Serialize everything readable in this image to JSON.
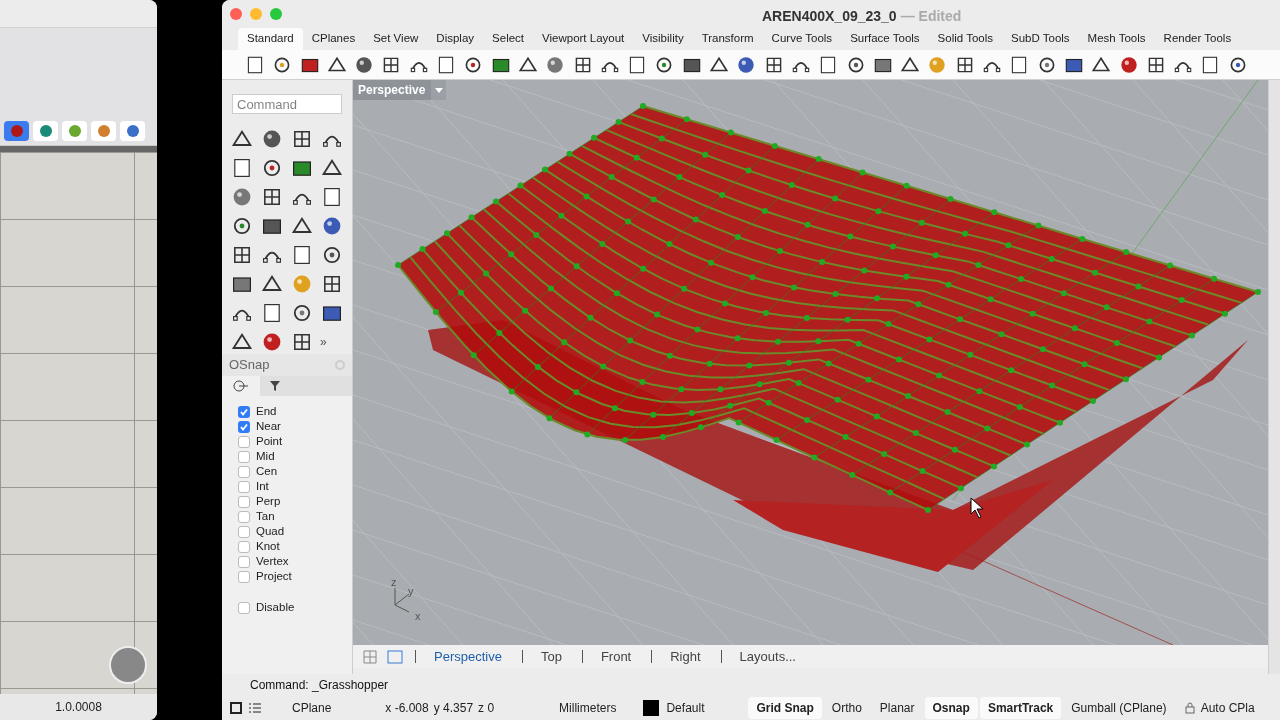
{
  "background_window": {
    "version": "1.0.0008"
  },
  "window": {
    "title": "AREN400X_09_23_0",
    "status": "— Edited"
  },
  "tabs": [
    {
      "label": "Standard",
      "selected": true
    },
    {
      "label": "CPlanes",
      "selected": false
    },
    {
      "label": "Set View",
      "selected": false
    },
    {
      "label": "Display",
      "selected": false
    },
    {
      "label": "Select",
      "selected": false
    },
    {
      "label": "Viewport Layout",
      "selected": false
    },
    {
      "label": "Visibility",
      "selected": false
    },
    {
      "label": "Transform",
      "selected": false
    },
    {
      "label": "Curve Tools",
      "selected": false
    },
    {
      "label": "Surface Tools",
      "selected": false
    },
    {
      "label": "Solid Tools",
      "selected": false
    },
    {
      "label": "SubD Tools",
      "selected": false
    },
    {
      "label": "Mesh Tools",
      "selected": false
    },
    {
      "label": "Render Tools",
      "selected": false
    }
  ],
  "command_field": {
    "placeholder": "Command"
  },
  "tool_palette": {
    "more": "»"
  },
  "osnap": {
    "title": "OSnap",
    "items": [
      {
        "label": "End",
        "checked": true
      },
      {
        "label": "Near",
        "checked": true
      },
      {
        "label": "Point",
        "checked": false
      },
      {
        "label": "Mid",
        "checked": false
      },
      {
        "label": "Cen",
        "checked": false
      },
      {
        "label": "Int",
        "checked": false
      },
      {
        "label": "Perp",
        "checked": false
      },
      {
        "label": "Tan",
        "checked": false
      },
      {
        "label": "Quad",
        "checked": false
      },
      {
        "label": "Knot",
        "checked": false
      },
      {
        "label": "Vertex",
        "checked": false
      },
      {
        "label": "Project",
        "checked": false
      }
    ],
    "disable": {
      "label": "Disable",
      "checked": false
    }
  },
  "viewport": {
    "title": "Perspective",
    "axes": {
      "z": "z",
      "y": "y",
      "x": "x"
    }
  },
  "viewport_tabs": [
    {
      "label": "Perspective",
      "selected": true
    },
    {
      "label": "Top",
      "selected": false
    },
    {
      "label": "Front",
      "selected": false
    },
    {
      "label": "Right",
      "selected": false
    },
    {
      "label": "Layouts...",
      "selected": false
    }
  ],
  "command_history": "Command: _Grasshopper",
  "status_bar": {
    "cplane": "CPlane",
    "x": "x -6.008",
    "y": "y 4.357",
    "z": "z 0",
    "units": "Millimeters",
    "layer": {
      "name": "Default",
      "color": "#000000"
    },
    "toggles": [
      {
        "label": "Grid Snap",
        "on": true
      },
      {
        "label": "Ortho",
        "on": false
      },
      {
        "label": "Planar",
        "on": false
      },
      {
        "label": "Osnap",
        "on": true
      },
      {
        "label": "SmartTrack",
        "on": true
      },
      {
        "label": "Gumball (CPlane)",
        "on": false
      }
    ],
    "auto_cplane": "Auto CPla"
  }
}
